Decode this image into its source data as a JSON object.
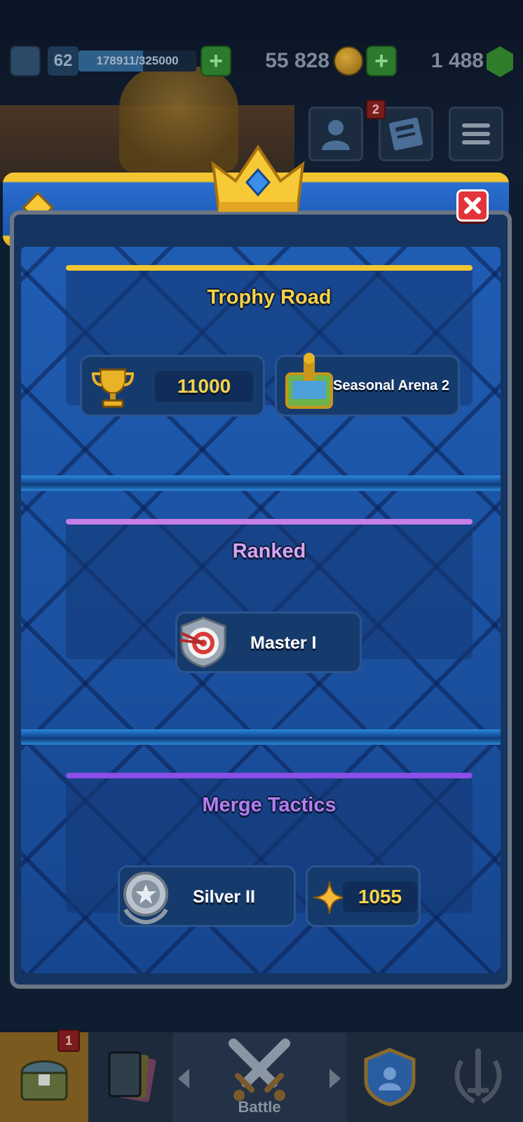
{
  "hud": {
    "level": "62",
    "xp_text": "178911/325000",
    "xp_progress": 0.55,
    "gold": "55 828",
    "gems": "1 488"
  },
  "header": {
    "news_badge": "2"
  },
  "trophy_road": {
    "title": "Trophy Road",
    "trophies": "11000",
    "arena": "Seasonal Arena 2",
    "accent": "#f2c531"
  },
  "ranked": {
    "title": "Ranked",
    "rank": "Master I",
    "accent": "#c67fe6"
  },
  "merge_tactics": {
    "title": "Merge Tactics",
    "league": "Silver II",
    "points": "1055",
    "accent": "#8b4ee6"
  },
  "bottom_nav": {
    "shop_badge": "1",
    "battle_label": "Battle"
  }
}
